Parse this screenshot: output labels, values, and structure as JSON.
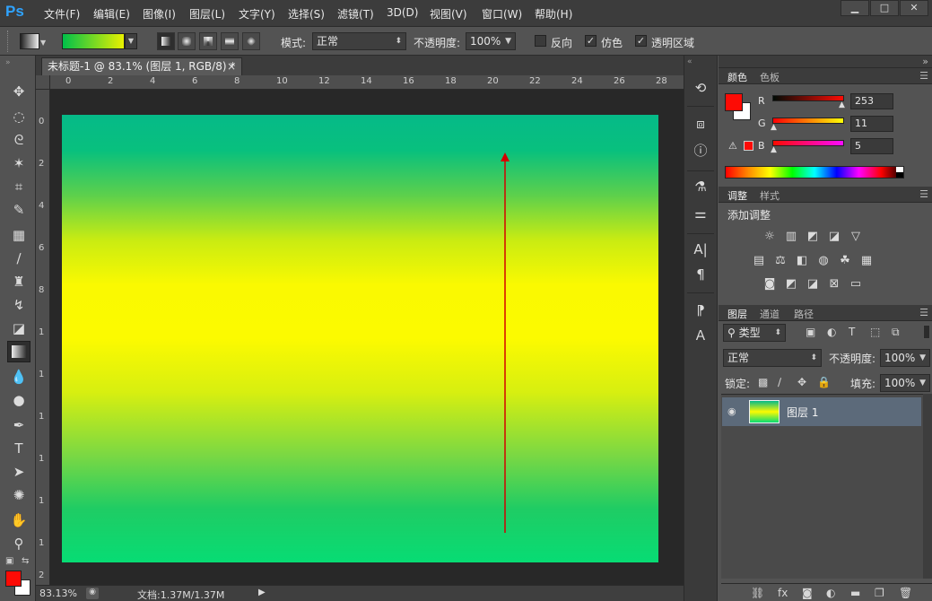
{
  "app": {
    "logo": "Ps"
  },
  "menu": [
    "文件(F)",
    "编辑(E)",
    "图像(I)",
    "图层(L)",
    "文字(Y)",
    "选择(S)",
    "滤镜(T)",
    "3D(D)",
    "视图(V)",
    "窗口(W)",
    "帮助(H)"
  ],
  "window_controls": {
    "minimize": "▁",
    "maximize": "□",
    "close": "✕"
  },
  "options": {
    "mode_label": "模式:",
    "mode_value": "正常",
    "opacity_label": "不透明度:",
    "opacity_value": "100%",
    "reverse_label": "反向",
    "dither_label": "仿色",
    "transparency_label": "透明区域",
    "dither_checked": "✓",
    "transparency_checked": "✓",
    "gradient_colors": [
      "#00c04a",
      "#e8f000"
    ]
  },
  "document": {
    "tab_title": "未标题-1 @ 83.1% (图层 1, RGB/8) *",
    "tab_close": "×",
    "ruler_h": [
      "0",
      "2",
      "4",
      "6",
      "8",
      "10",
      "12",
      "14",
      "16",
      "18",
      "20",
      "22",
      "24",
      "26",
      "28"
    ],
    "ruler_v": [
      "0",
      "2",
      "4",
      "6",
      "8",
      "1",
      "1",
      "1",
      "1",
      "1",
      "1",
      "2"
    ],
    "gradient_colors": {
      "top": "#06ba88",
      "middle": "#fcfa00",
      "bottom": "#07dc74"
    }
  },
  "status": {
    "zoom": "83.13%",
    "doc_info": "文档:1.37M/1.37M"
  },
  "color_panel": {
    "tabs": [
      "颜色",
      "色板"
    ],
    "r_label": "R",
    "g_label": "G",
    "b_label": "B",
    "r": "253",
    "g": "11",
    "b": "5",
    "foreground": "#fd0b05",
    "background": "#ffffff"
  },
  "adjust_panel": {
    "tabs": [
      "调整",
      "样式"
    ],
    "title": "添加调整"
  },
  "layers_panel": {
    "tabs": [
      "图层",
      "通道",
      "路径"
    ],
    "kind_filter": "类型",
    "blend_mode": "正常",
    "opacity_label": "不透明度:",
    "opacity_value": "100%",
    "lock_label": "锁定:",
    "fill_label": "填充:",
    "fill_value": "100%",
    "layers": [
      {
        "name": "图层 1"
      }
    ]
  }
}
